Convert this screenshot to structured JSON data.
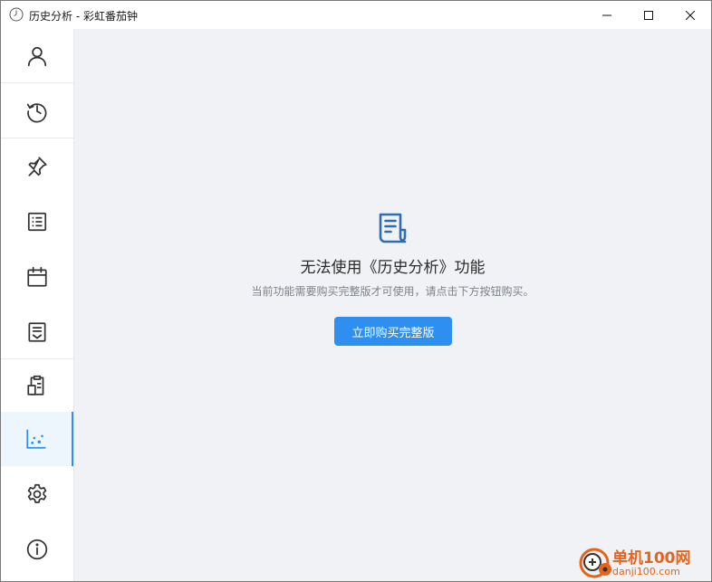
{
  "window": {
    "title": "历史分析 - 彩虹番茄钟",
    "controls": {
      "minimize": "minimize-icon",
      "maximize": "maximize-icon",
      "close": "close-icon"
    }
  },
  "sidebar": {
    "active_index": 7,
    "accent_color": "#2f8ff0",
    "items": [
      {
        "icon": "user-icon"
      },
      {
        "icon": "clock-icon"
      },
      {
        "icon": "pin-icon"
      },
      {
        "icon": "list-icon"
      },
      {
        "icon": "calendar-icon"
      },
      {
        "icon": "inbox-icon"
      },
      {
        "icon": "clipboard-icon"
      },
      {
        "icon": "scatter-chart-icon"
      },
      {
        "icon": "settings-icon"
      },
      {
        "icon": "info-icon"
      }
    ]
  },
  "main": {
    "icon": "document-icon",
    "title": "无法使用《历史分析》功能",
    "description": "当前功能需要购买完整版才可使用，请点击下方按钮购买。",
    "button_label": "立即购买完整版",
    "button_color": "#2f8ff0"
  },
  "watermark": {
    "text": "单机100网",
    "url": "danji100.com",
    "color": "#e8631a"
  }
}
